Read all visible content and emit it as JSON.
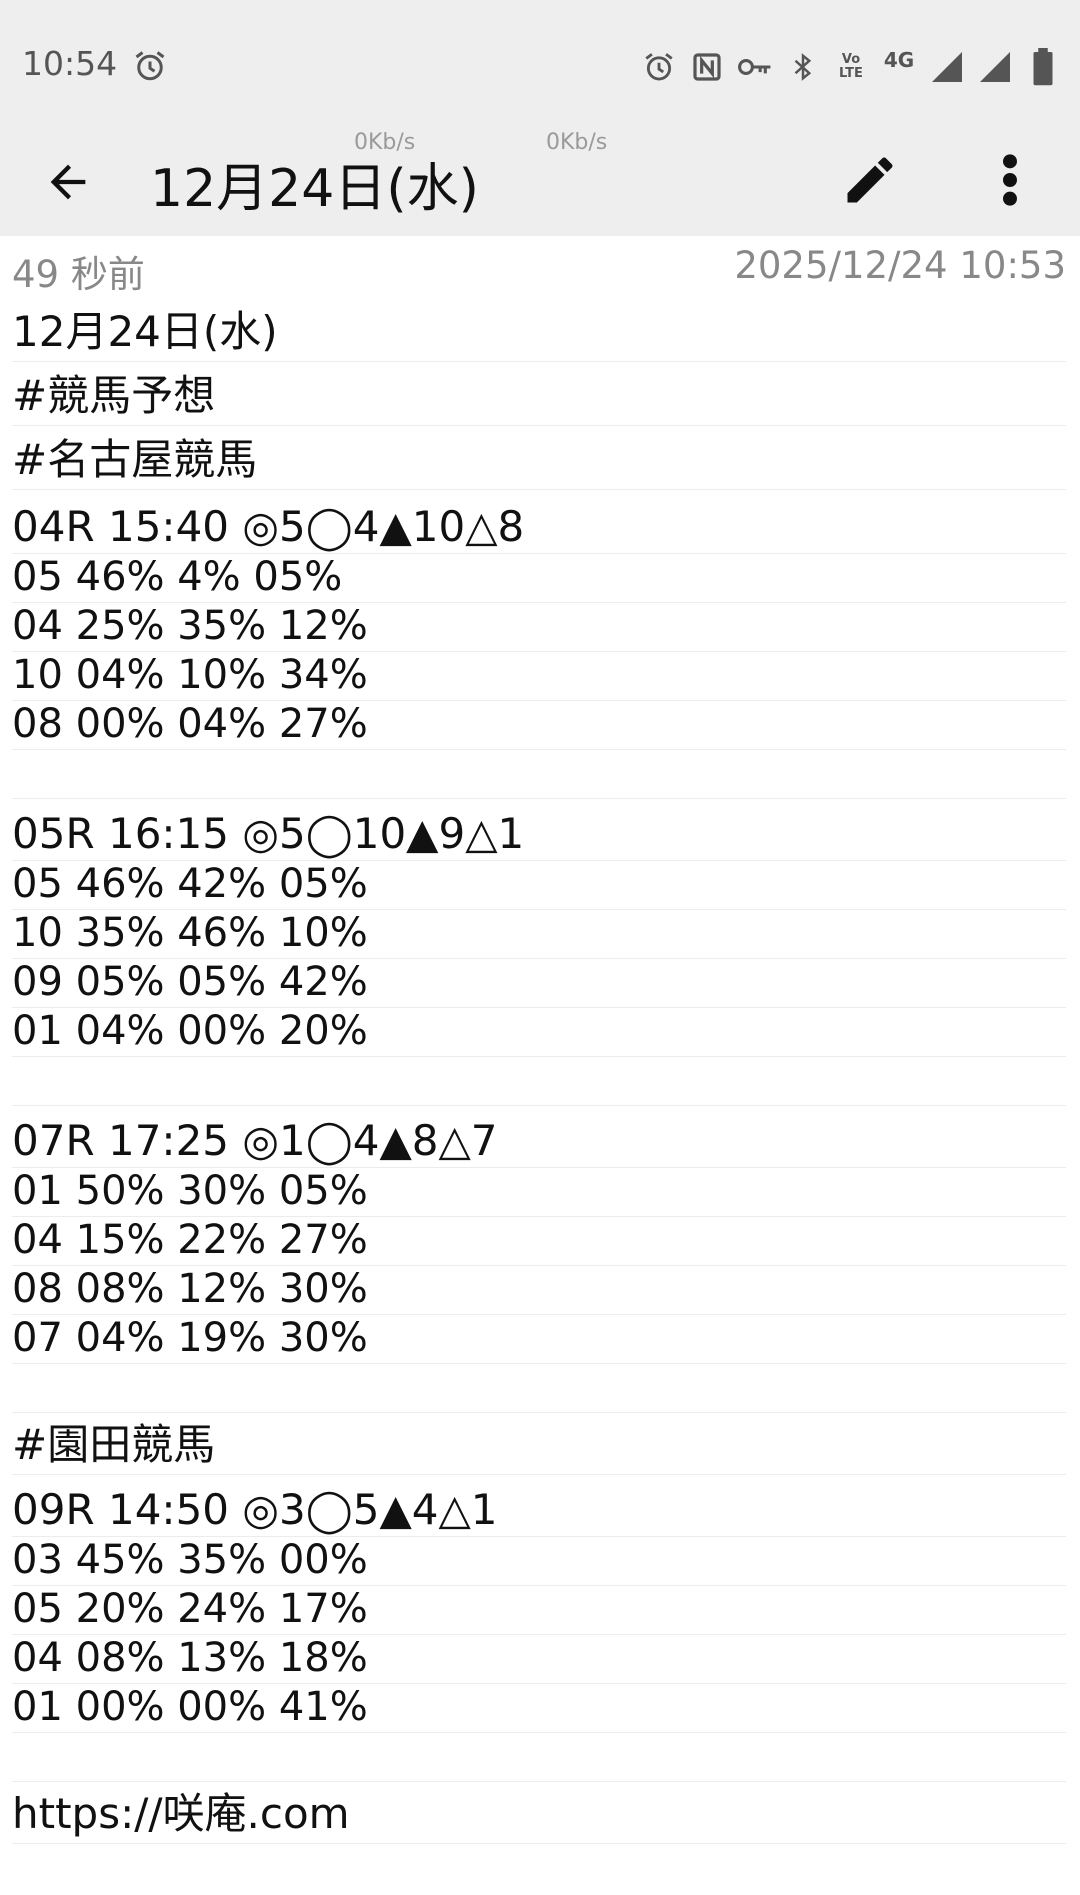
{
  "status_bar": {
    "time": "10:54",
    "icons": [
      "alarm-icon",
      "nfc-icon",
      "vpn-key-icon",
      "bluetooth-icon",
      "volte-icon",
      "network-4g-icon",
      "signal-icon",
      "signal-icon",
      "battery-icon"
    ],
    "volte_label_top": "Vo",
    "volte_label_bottom": "LTE",
    "network_label": "4G",
    "speed_1": "0Kb/s",
    "speed_2": "0Kb/s"
  },
  "app_bar": {
    "title": "12月24日(水)"
  },
  "meta": {
    "relative_time": "49 秒前",
    "timestamp": "2025/12/24 10:53"
  },
  "note_lines": [
    "12月24日(水)",
    "#競馬予想",
    "#名古屋競馬",
    "04R 15:40 ◎5◯4▲10△8",
    "05 46% 4% 05%",
    "04 25% 35% 12%",
    "10 04% 10% 34%",
    "08 00% 04% 27%",
    "",
    "05R 16:15 ◎5◯10▲9△1",
    "05 46% 42% 05%",
    "10 35% 46% 10%",
    "09 05% 05% 42%",
    "01 04% 00% 20%",
    "",
    "07R 17:25 ◎1◯4▲8△7",
    "01 50% 30% 05%",
    "04 15% 22% 27%",
    "08 08% 12% 30%",
    "07 04% 19% 30%",
    "",
    "#園田競馬",
    "09R 14:50 ◎3◯5▲4△1",
    "03 45% 35% 00%",
    "05 20% 24% 17%",
    "04 08% 13% 18%",
    "01 00% 00% 41%",
    "",
    "https://咲庵.com"
  ]
}
